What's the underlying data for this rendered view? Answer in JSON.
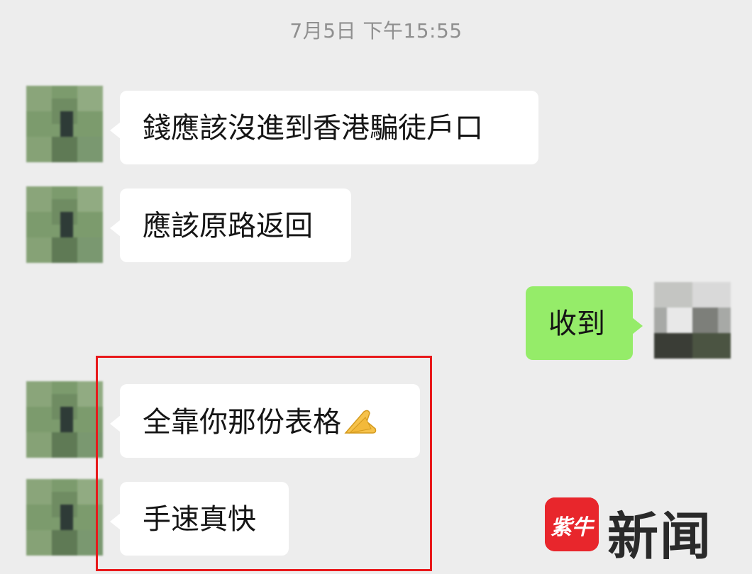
{
  "chat": {
    "timestamp": "7月5日 下午15:55",
    "messages": [
      {
        "side": "left",
        "text": "錢應該沒進到香港騙徒戶口"
      },
      {
        "side": "left",
        "text": "應該原路返回"
      },
      {
        "side": "right",
        "text": "收到"
      },
      {
        "side": "left",
        "text": "全靠你那份表格",
        "emoji": "folded-hands-emoji"
      },
      {
        "side": "left",
        "text": "手速真快"
      }
    ]
  },
  "watermark": {
    "logo_text": "紫牛",
    "brand_text": "新闻"
  },
  "colors": {
    "background": "#ededed",
    "incoming_bubble": "#ffffff",
    "outgoing_bubble": "#95ec69",
    "highlight_border": "#e8191b",
    "logo_red": "#e8262c",
    "timestamp_text": "#8f8f8f"
  }
}
